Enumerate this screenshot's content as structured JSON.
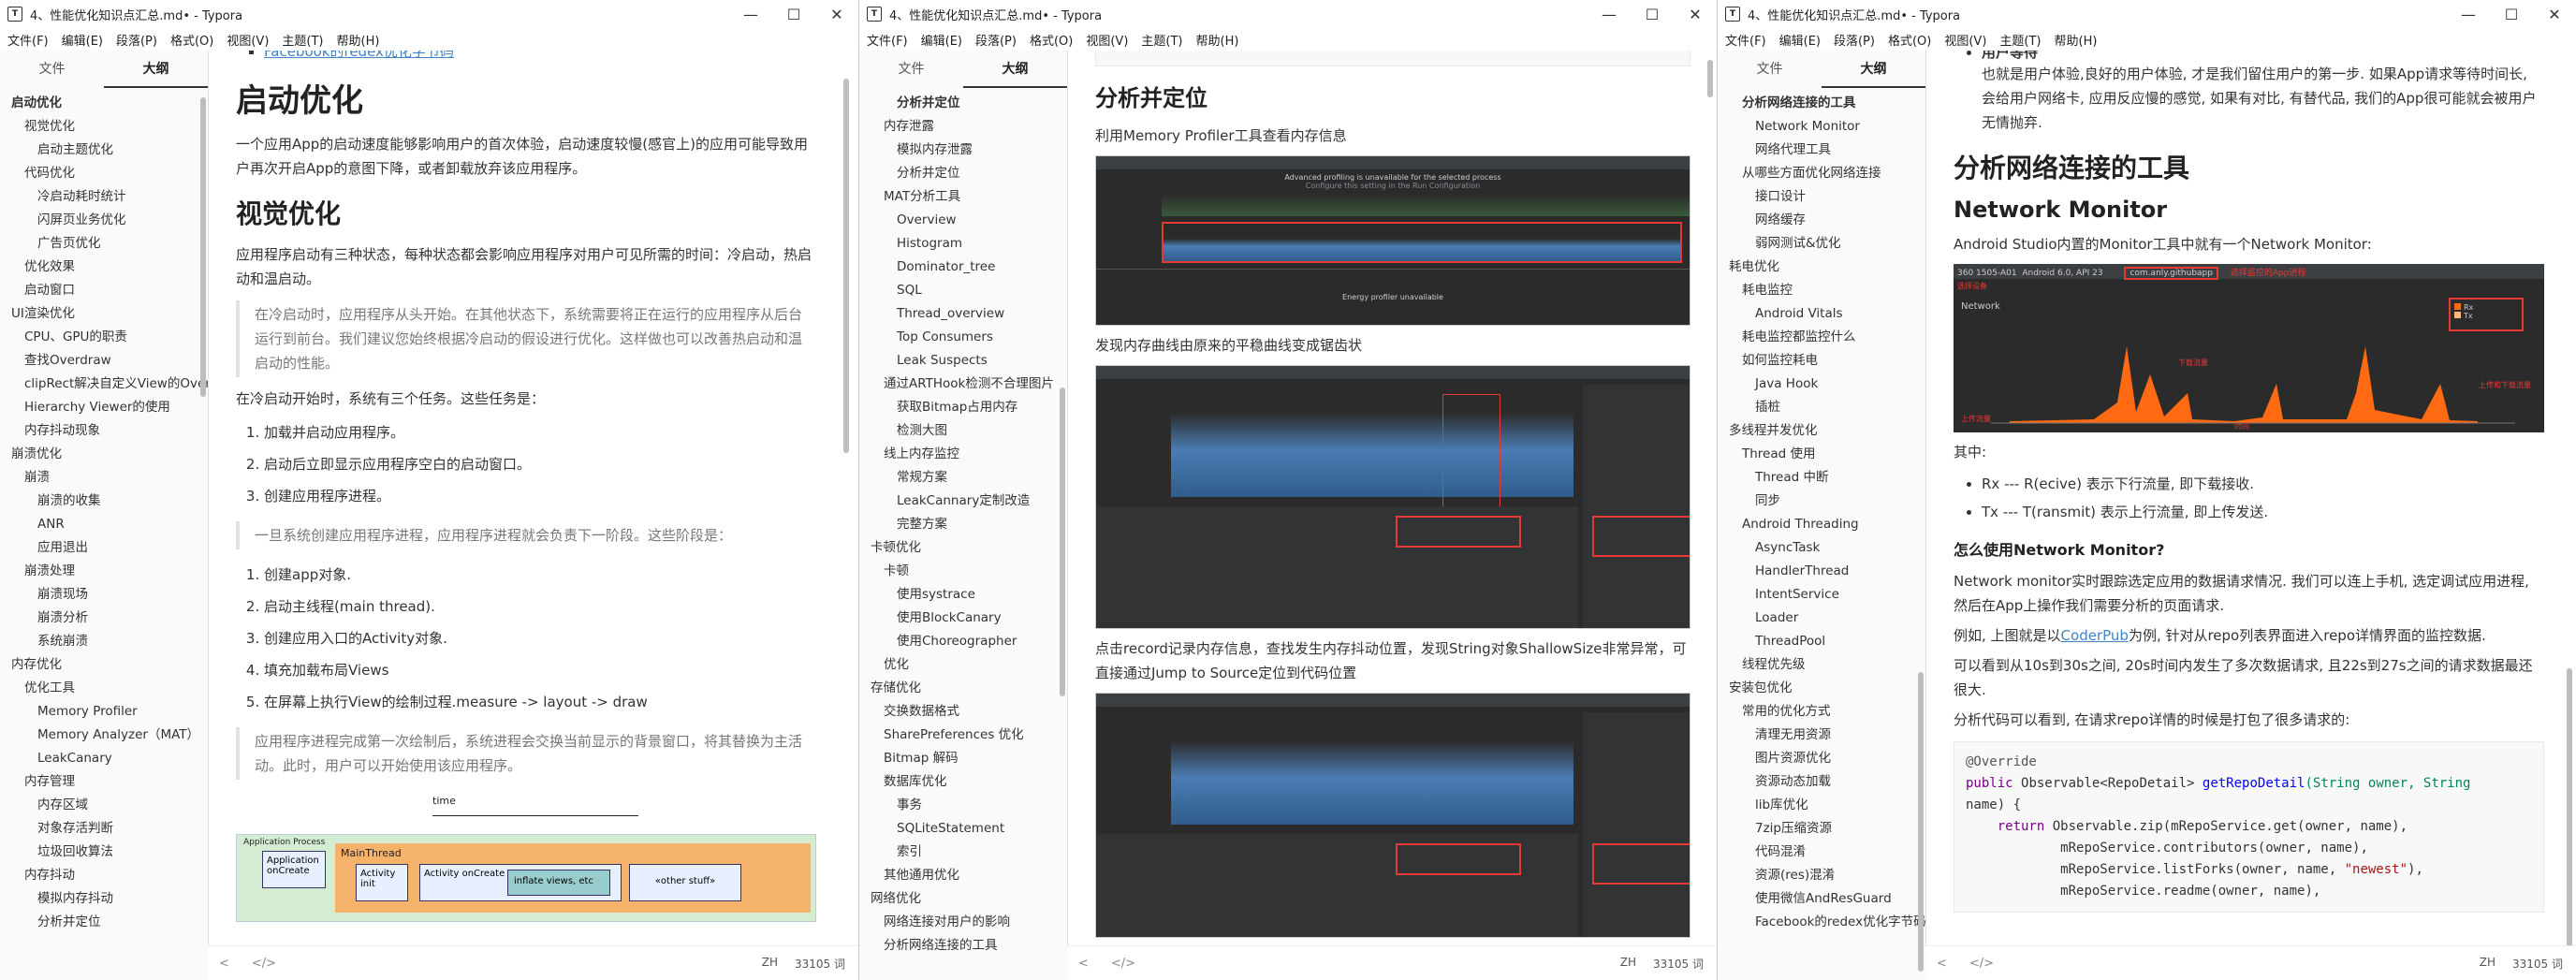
{
  "windows": [
    {
      "title": "4、性能优化知识点汇总.md• - Typora",
      "menu": [
        "文件(F)",
        "编辑(E)",
        "段落(P)",
        "格式(O)",
        "视图(V)",
        "主题(T)",
        "帮助(H)"
      ],
      "sidebar_tabs": [
        "文件",
        "大纲"
      ],
      "outline": [
        {
          "label": "启动优化",
          "level": 0,
          "bold": true
        },
        {
          "label": "视觉优化",
          "level": 1
        },
        {
          "label": "启动主题优化",
          "level": 2
        },
        {
          "label": "代码优化",
          "level": 1
        },
        {
          "label": "冷启动耗时统计",
          "level": 2
        },
        {
          "label": "闪屏页业务优化",
          "level": 2
        },
        {
          "label": "广告页优化",
          "level": 2
        },
        {
          "label": "优化效果",
          "level": 1
        },
        {
          "label": "启动窗口",
          "level": 1
        },
        {
          "label": "UI渲染优化",
          "level": 0
        },
        {
          "label": "CPU、GPU的职责",
          "level": 1
        },
        {
          "label": "查找Overdraw",
          "level": 1
        },
        {
          "label": "clipRect解决自定义View的OverDraw",
          "level": 1
        },
        {
          "label": "Hierarchy Viewer的使用",
          "level": 1
        },
        {
          "label": "内存抖动现象",
          "level": 1
        },
        {
          "label": "崩溃优化",
          "level": 0
        },
        {
          "label": "崩溃",
          "level": 1
        },
        {
          "label": "崩溃的收集",
          "level": 2
        },
        {
          "label": "ANR",
          "level": 2
        },
        {
          "label": "应用退出",
          "level": 2
        },
        {
          "label": "崩溃处理",
          "level": 1
        },
        {
          "label": "崩溃现场",
          "level": 2
        },
        {
          "label": "崩溃分析",
          "level": 2
        },
        {
          "label": "系统崩溃",
          "level": 2
        },
        {
          "label": "内存优化",
          "level": 0
        },
        {
          "label": "优化工具",
          "level": 1
        },
        {
          "label": "Memory Profiler",
          "level": 2
        },
        {
          "label": "Memory Analyzer（MAT）",
          "level": 2
        },
        {
          "label": "LeakCanary",
          "level": 2
        },
        {
          "label": "内存管理",
          "level": 1
        },
        {
          "label": "内存区域",
          "level": 2
        },
        {
          "label": "对象存活判断",
          "level": 2
        },
        {
          "label": "垃圾回收算法",
          "level": 2
        },
        {
          "label": "内存抖动",
          "level": 1
        },
        {
          "label": "模拟内存抖动",
          "level": 2
        },
        {
          "label": "分析并定位",
          "level": 2
        }
      ],
      "top_link": "Facebook的redex优化字节码",
      "h1": "启动优化",
      "intro": "一个应用App的启动速度能够影响用户的首次体验，启动速度较慢(感官上)的应用可能导致用户再次开启App的意图下降，或者卸载放弃该应用程序。",
      "h2": "视觉优化",
      "p1": "应用程序启动有三种状态，每种状态都会影响应用程序对用户可见所需的时间：冷启动，热启动和温启动。",
      "quote1": "在冷启动时，应用程序从头开始。在其他状态下，系统需要将正在运行的应用程序从后台运行到前台。我们建议您始终根据冷启动的假设进行优化。这样做也可以改善热启动和温启动的性能。",
      "p2": "在冷启动开始时，系统有三个任务。这些任务是：",
      "list1": [
        "加载并启动应用程序。",
        "启动后立即显示应用程序空白的启动窗口。",
        "创建应用程序进程。"
      ],
      "quote2": "一旦系统创建应用程序进程，应用程序进程就会负责下一阶段。这些阶段是：",
      "list2": [
        "创建app对象.",
        "启动主线程(main thread).",
        "创建应用入口的Activity对象.",
        "填充加载布局Views",
        "在屏幕上执行View的绘制过程.measure -> layout -> draw"
      ],
      "quote3": "应用程序进程完成第一次绘制后，系统进程会交换当前显示的背景窗口，将其替换为主活动。此时，用户可以开始使用该应用程序。",
      "diagram": {
        "time": "time",
        "app_process": "Application Process",
        "app_oncreate": "Application onCreate",
        "mainthread": "MainThread",
        "activity_init": "Activity init",
        "activity_oncreate": "Activity onCreate",
        "inflate": "inflate views, etc",
        "other": "«other stuff»"
      },
      "status": {
        "lang": "ZH",
        "words": "33105 词"
      }
    },
    {
      "title": "4、性能优化知识点汇总.md• - Typora",
      "menu": [
        "文件(F)",
        "编辑(E)",
        "段落(P)",
        "格式(O)",
        "视图(V)",
        "主题(T)",
        "帮助(H)"
      ],
      "sidebar_tabs": [
        "文件",
        "大纲"
      ],
      "outline": [
        {
          "label": "分析并定位",
          "level": 2,
          "bold": true
        },
        {
          "label": "内存泄露",
          "level": 1
        },
        {
          "label": "模拟内存泄露",
          "level": 2
        },
        {
          "label": "分析并定位",
          "level": 2
        },
        {
          "label": "MAT分析工具",
          "level": 1
        },
        {
          "label": "Overview",
          "level": 2
        },
        {
          "label": "Histogram",
          "level": 2
        },
        {
          "label": "Dominator_tree",
          "level": 2
        },
        {
          "label": "SQL",
          "level": 2
        },
        {
          "label": "Thread_overview",
          "level": 2
        },
        {
          "label": "Top Consumers",
          "level": 2
        },
        {
          "label": "Leak Suspects",
          "level": 2
        },
        {
          "label": "通过ARTHook检测不合理图片",
          "level": 1
        },
        {
          "label": "获取Bitmap占用内存",
          "level": 2
        },
        {
          "label": "检测大图",
          "level": 2
        },
        {
          "label": "线上内存监控",
          "level": 1
        },
        {
          "label": "常规方案",
          "level": 2
        },
        {
          "label": "LeakCannary定制改造",
          "level": 2
        },
        {
          "label": "完整方案",
          "level": 2
        },
        {
          "label": "卡顿优化",
          "level": 0
        },
        {
          "label": "卡顿",
          "level": 1
        },
        {
          "label": "使用systrace",
          "level": 2
        },
        {
          "label": "使用BlockCanary",
          "level": 2
        },
        {
          "label": "使用Choreographer",
          "level": 2
        },
        {
          "label": "优化",
          "level": 1
        },
        {
          "label": "存储优化",
          "level": 0
        },
        {
          "label": "交换数据格式",
          "level": 1
        },
        {
          "label": "SharePreferences 优化",
          "level": 1
        },
        {
          "label": "Bitmap 解码",
          "level": 1
        },
        {
          "label": "数据库优化",
          "level": 1
        },
        {
          "label": "事务",
          "level": 2
        },
        {
          "label": "SQLiteStatement",
          "level": 2
        },
        {
          "label": "索引",
          "level": 2
        },
        {
          "label": "其他通用优化",
          "level": 1
        },
        {
          "label": "网络优化",
          "level": 0
        },
        {
          "label": "网络连接对用户的影响",
          "level": 1
        },
        {
          "label": "分析网络连接的工具",
          "level": 1
        }
      ],
      "h2": "分析并定位",
      "p1": "利用Memory Profiler工具查看内存信息",
      "p2": "发现内存曲线由原来的平稳曲线变成锯齿状",
      "p3": "点击record记录内存信息，查找发生内存抖动位置，发现String对象ShallowSize非常异常，可直接通过Jump to Source定位到代码位置",
      "shot1": {
        "banner": "Advanced profiling is unavailable for the selected process",
        "banner_sub": "Configure this setting in the Run Configuration",
        "bottom": "Energy profiler unavailable"
      },
      "status": {
        "lang": "ZH",
        "words": "33105 词"
      }
    },
    {
      "title": "4、性能优化知识点汇总.md• - Typora",
      "menu": [
        "文件(F)",
        "编辑(E)",
        "段落(P)",
        "格式(O)",
        "视图(V)",
        "主题(T)",
        "帮助(H)"
      ],
      "sidebar_tabs": [
        "文件",
        "大纲"
      ],
      "outline": [
        {
          "label": "分析网络连接的工具",
          "level": 1,
          "bold": true
        },
        {
          "label": "Network Monitor",
          "level": 2
        },
        {
          "label": "网络代理工具",
          "level": 2
        },
        {
          "label": "从哪些方面优化网络连接",
          "level": 1
        },
        {
          "label": "接口设计",
          "level": 2
        },
        {
          "label": "网络缓存",
          "level": 2
        },
        {
          "label": "弱网测试&优化",
          "level": 2
        },
        {
          "label": "耗电优化",
          "level": 0
        },
        {
          "label": "耗电监控",
          "level": 1
        },
        {
          "label": "Android Vitals",
          "level": 2
        },
        {
          "label": "耗电监控都监控什么",
          "level": 1
        },
        {
          "label": "如何监控耗电",
          "level": 1
        },
        {
          "label": "Java Hook",
          "level": 2
        },
        {
          "label": "插桩",
          "level": 2
        },
        {
          "label": "多线程并发优化",
          "level": 0
        },
        {
          "label": "Thread 使用",
          "level": 1
        },
        {
          "label": "Thread 中断",
          "level": 2
        },
        {
          "label": "同步",
          "level": 2
        },
        {
          "label": "Android Threading",
          "level": 1
        },
        {
          "label": "AsyncTask",
          "level": 2
        },
        {
          "label": "HandlerThread",
          "level": 2
        },
        {
          "label": "IntentService",
          "level": 2
        },
        {
          "label": "Loader",
          "level": 2
        },
        {
          "label": "ThreadPool",
          "level": 2
        },
        {
          "label": "线程优先级",
          "level": 1
        },
        {
          "label": "安装包优化",
          "level": 0
        },
        {
          "label": "常用的优化方式",
          "level": 1
        },
        {
          "label": "清理无用资源",
          "level": 2
        },
        {
          "label": "图片资源优化",
          "level": 2
        },
        {
          "label": "资源动态加载",
          "level": 2
        },
        {
          "label": "lib库优化",
          "level": 2
        },
        {
          "label": "7zip压缩资源",
          "level": 2
        },
        {
          "label": "代码混淆",
          "level": 2
        },
        {
          "label": "资源(res)混淆",
          "level": 2
        },
        {
          "label": "使用微信AndResGuard",
          "level": 2
        },
        {
          "label": "Facebook的redex优化字节码",
          "level": 2
        }
      ],
      "top_item": "用户等待",
      "p_top": "也就是用户体验,良好的用户体验, 才是我们留住用户的第一步. 如果App请求等待时间长, 会给用户网络卡, 应用反应慢的感觉, 如果有对比, 有替代品, 我们的App很可能就会被用户无情抛弃.",
      "h2": "分析网络连接的工具",
      "h3": "Network Monitor",
      "p1": "Android Studio内置的Monitor工具中就有一个Network Monitor:",
      "p2": "其中:",
      "bullets": [
        "Rx --- R(ecive) 表示下行流量, 即下载接收.",
        "Tx --- T(ransmit) 表示上行流量, 即上传发送."
      ],
      "h4": "怎么使用Network Monitor?",
      "p3": "Network monitor实时跟踪选定应用的数据请求情况. 我们可以连上手机, 选定调试应用进程, 然后在App上操作我们需要分析的页面请求.",
      "p4_pre": "例如, 上图就是以",
      "p4_link": "CoderPub",
      "p4_post": "为例, 针对从repo列表界面进入repo详情界面的监控数据.",
      "p5": "可以看到从10s到30s之间, 20s时间内发生了多次数据请求, 且22s到27s之间的请求数据最还很大.",
      "p6": "分析代码可以看到, 在请求repo详情的时候是打包了很多请求的:",
      "code": {
        "l1": "@Override",
        "l2a": "public",
        "l2b": "Observable<RepoDetail>",
        "l2c": "getRepoDetail",
        "l2d": "(String owner, String",
        "l3": "name) {",
        "l4a": "return",
        "l4b": "Observable.zip(mRepoService.get(owner, name),",
        "l5": "mRepoService.contributors(owner, name),",
        "l6a": "mRepoService.listForks(owner, name, ",
        "l6b": "\"newest\"",
        "l6c": "),",
        "l7": "mRepoService.readme(owner, name),"
      },
      "net": {
        "device": "360 1505-A01",
        "os": "Android 6.0, API 23",
        "app": "com.anly.githubapp",
        "tab": "Network",
        "rx_label": "Rx",
        "tx_label": "Tx",
        "ann_device": "选择设备",
        "ann_app": "选择监控的App进程",
        "ann_rx": "下载流量",
        "ann_tx": "上传流量",
        "ann_legend": "上传和下载流量",
        "ann_time": "时间"
      },
      "status": {
        "lang": "ZH",
        "words": "33105 词"
      }
    }
  ]
}
